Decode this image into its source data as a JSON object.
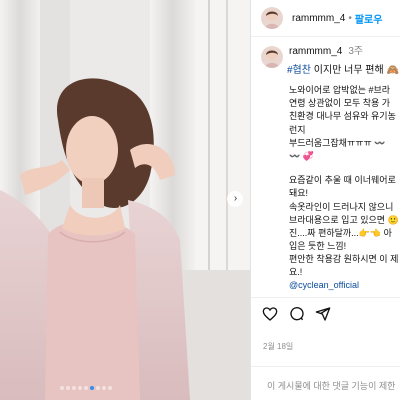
{
  "header": {
    "username": "rammmm_4",
    "separator": "•",
    "follow_label": "팔로우"
  },
  "caption": {
    "username": "rammmm_4",
    "time_ago": "3주",
    "hashtag": "#협찬",
    "headline": " 이지만 너무 편해 🙈",
    "lines": [
      "노와이어로 압박없는 #브라",
      "연령 상관없이 모두 착용 가",
      "친환경 대나무 섬유와 유기농",
      "런지",
      "부드러움그잡채ㅠㅠㅠ 〰️",
      "〰️ 💞",
      "",
      "요즘같이 추울 때 이너웨어로",
      "돼요!",
      "속옷라인이 드러나지 않으니",
      "브라대용으로 입고 있으면 🙂",
      "진....짜 편하달까...👉👈 아",
      "입은 듯한 느낌!",
      "편안한 착용감 원하시면 이 제",
      "요.!"
    ],
    "mention": "@cyclean_official"
  },
  "post": {
    "date": "2월 18일",
    "comments_disabled": "이 게시물에 대한 댓글 기능이 제한"
  },
  "carousel": {
    "next_icon": "chevron-right-icon",
    "dot_count": 9,
    "active_index": 5
  },
  "colors": {
    "accent": "#0095f6",
    "hashtag": "#0a4a9c",
    "muted": "#8e8e8e",
    "active_dot": "#2f8ef0"
  }
}
